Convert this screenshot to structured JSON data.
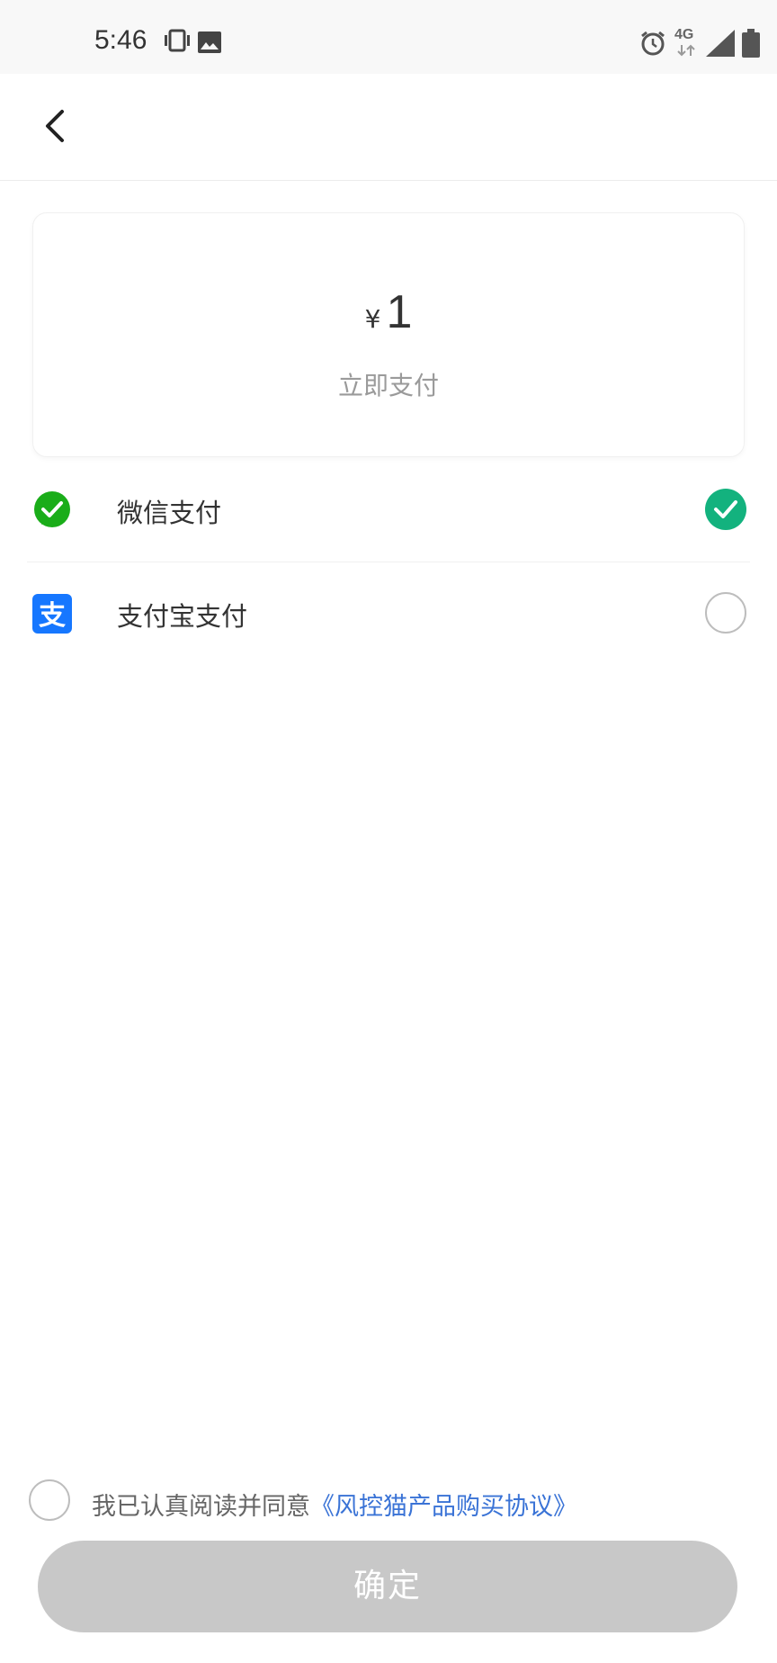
{
  "status_bar": {
    "time": "5:46",
    "network": "4G",
    "icons": [
      "vibrate-icon",
      "image-icon",
      "alarm-icon",
      "signal-icon",
      "battery-icon"
    ]
  },
  "header": {
    "back_icon": "chevron-left-icon"
  },
  "amount_card": {
    "currency": "¥",
    "amount": "1",
    "subtitle": "立即支付"
  },
  "payment_methods": [
    {
      "label": "微信支付",
      "icon": "wechat-pay-icon",
      "selected": true,
      "color": "#1aad19"
    },
    {
      "label": "支付宝支付",
      "icon": "alipay-icon",
      "selected": false,
      "color": "#1677ff"
    }
  ],
  "agreement": {
    "prefix": "我已认真阅读并同意",
    "link": "《风控猫产品购买协议》",
    "checked": false
  },
  "confirm_button": {
    "label": "确定"
  },
  "colors": {
    "accent_green": "#13b27e",
    "link_blue": "#3a73d6",
    "disabled_button": "#c8c8c8"
  }
}
